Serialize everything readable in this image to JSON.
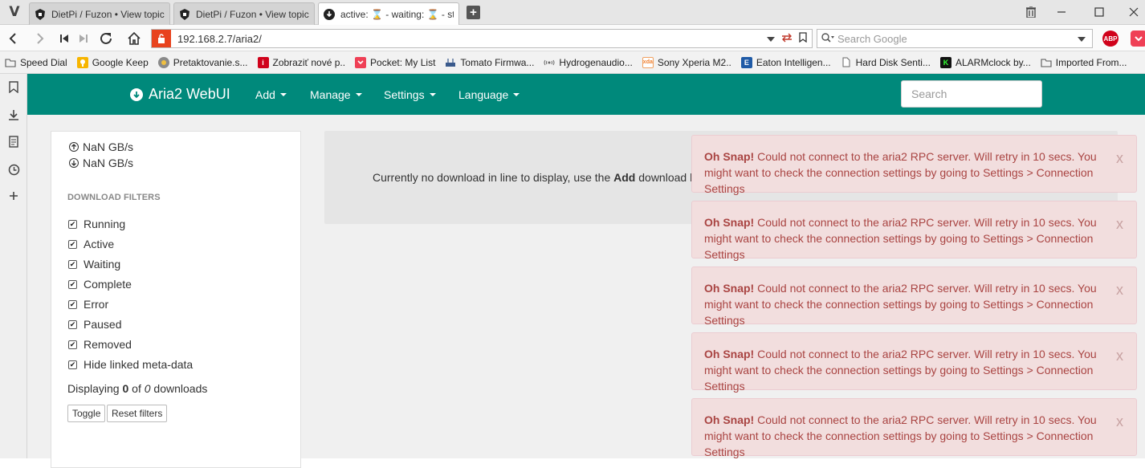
{
  "browser": {
    "tabs": [
      {
        "title": "DietPi / Fuzon • View topic -",
        "icon": "dietpi-icon",
        "active": false
      },
      {
        "title": "DietPi / Fuzon • View topic -",
        "icon": "dietpi-icon",
        "active": false
      },
      {
        "title": "active: ⌛ - waiting: ⌛ - stop",
        "icon": "download-icon",
        "active": true
      }
    ],
    "address": "192.168.2.7/aria2/",
    "search_placeholder": "Search Google",
    "abp_label": "ABP",
    "bookmarks": [
      {
        "label": "Speed Dial",
        "icon": "folder-icon"
      },
      {
        "label": "Google Keep",
        "icon": "keep-icon"
      },
      {
        "label": "Pretaktovanie.s...",
        "icon": "site-icon"
      },
      {
        "label": "Zobraziť nové p..",
        "icon": "info-icon"
      },
      {
        "label": "Pocket: My List",
        "icon": "pocket-icon"
      },
      {
        "label": "Tomato Firmwa...",
        "icon": "router-icon"
      },
      {
        "label": "Hydrogenaudio...",
        "icon": "wave-icon"
      },
      {
        "label": "Sony Xperia M2..",
        "icon": "xda-icon"
      },
      {
        "label": "Eaton Intelligen...",
        "icon": "eaton-icon"
      },
      {
        "label": "Hard Disk Senti...",
        "icon": "page-icon"
      },
      {
        "label": "ALARMclock by...",
        "icon": "k-icon"
      },
      {
        "label": "Imported From...",
        "icon": "folder-icon"
      }
    ]
  },
  "app": {
    "brand": "Aria2 WebUI",
    "menu": [
      "Add",
      "Manage",
      "Settings",
      "Language"
    ],
    "search_placeholder": "Search",
    "speed_up": "NaN GB/s",
    "speed_down": "NaN GB/s",
    "filters_title": "DOWNLOAD FILTERS",
    "filters": [
      {
        "label": "Running",
        "checked": true
      },
      {
        "label": "Active",
        "checked": true
      },
      {
        "label": "Waiting",
        "checked": true
      },
      {
        "label": "Complete",
        "checked": true
      },
      {
        "label": "Error",
        "checked": true
      },
      {
        "label": "Paused",
        "checked": true
      },
      {
        "label": "Removed",
        "checked": true
      },
      {
        "label": "Hide linked meta-data",
        "checked": true
      }
    ],
    "displaying_prefix": "Displaying ",
    "displaying_count": "0",
    "displaying_mid": " of ",
    "displaying_total": "0",
    "displaying_suffix": " downloads",
    "toggle_label": "Toggle",
    "reset_label": "Reset filters",
    "empty_prefix": "Currently no download in line to display, use the ",
    "empty_bold": "Add",
    "empty_suffix": " download bu",
    "alerts": [
      {
        "title": "Oh Snap!",
        "message": "Could not connect to the aria2 RPC server. Will retry in 10 secs. You might want to check the connection settings by going to Settings > Connection Settings",
        "close": "x"
      },
      {
        "title": "Oh Snap!",
        "message": "Could not connect to the aria2 RPC server. Will retry in 10 secs. You might want to check the connection settings by going to Settings > Connection Settings",
        "close": "x"
      },
      {
        "title": "Oh Snap!",
        "message": "Could not connect to the aria2 RPC server. Will retry in 10 secs. You might want to check the connection settings by going to Settings > Connection Settings",
        "close": "x"
      },
      {
        "title": "Oh Snap!",
        "message": "Could not connect to the aria2 RPC server. Will retry in 10 secs. You might want to check the connection settings by going to Settings > Connection Settings",
        "close": "x"
      },
      {
        "title": "Oh Snap!",
        "message": "Could not connect to the aria2 RPC server. Will retry in 10 secs. You might want to check the connection settings by going to Settings > Connection Settings",
        "close": "x"
      }
    ]
  },
  "colors": {
    "appbar": "#00897b",
    "alert_bg": "#f2dede",
    "alert_text": "#a94442"
  }
}
